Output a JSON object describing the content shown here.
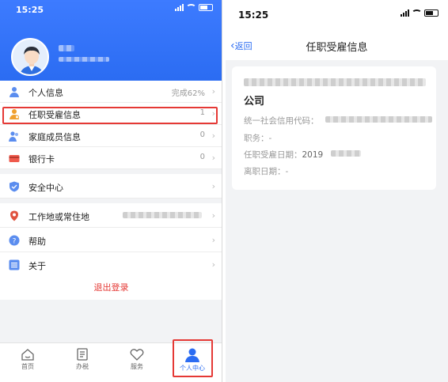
{
  "left": {
    "status_time": "15:25",
    "menu": [
      {
        "label": "个人信息",
        "value": "完成62%",
        "icon": "person-icon"
      },
      {
        "label": "任职受雇信息",
        "value": "1",
        "icon": "employment-icon"
      },
      {
        "label": "家庭成员信息",
        "value": "0",
        "icon": "family-icon"
      },
      {
        "label": "银行卡",
        "value": "0",
        "icon": "bank-card-icon"
      },
      {
        "label": "安全中心",
        "value": "",
        "icon": "shield-icon"
      },
      {
        "label": "工作地或常住地",
        "value": "",
        "icon": "location-icon"
      },
      {
        "label": "帮助",
        "value": "",
        "icon": "help-icon"
      },
      {
        "label": "关于",
        "value": "",
        "icon": "about-icon"
      }
    ],
    "logout": "退出登录",
    "tabs": [
      {
        "label": "首页",
        "icon": "home-icon"
      },
      {
        "label": "办税",
        "icon": "tax-icon"
      },
      {
        "label": "服务",
        "icon": "service-icon"
      },
      {
        "label": "个人中心",
        "icon": "profile-icon"
      }
    ],
    "accent": "#2b6cf2",
    "highlight_color": "#e53935"
  },
  "right": {
    "status_time": "15:25",
    "back_label": "返回",
    "title": "任职受雇信息",
    "company_suffix": "公司",
    "fields": {
      "credit_code_label": "统一社会信用代码：",
      "position_label": "职务：",
      "position_value": "-",
      "hire_date_label": "任职受雇日期：",
      "hire_date_value": "2019",
      "leave_date_label": "离职日期：",
      "leave_date_value": "-"
    }
  }
}
